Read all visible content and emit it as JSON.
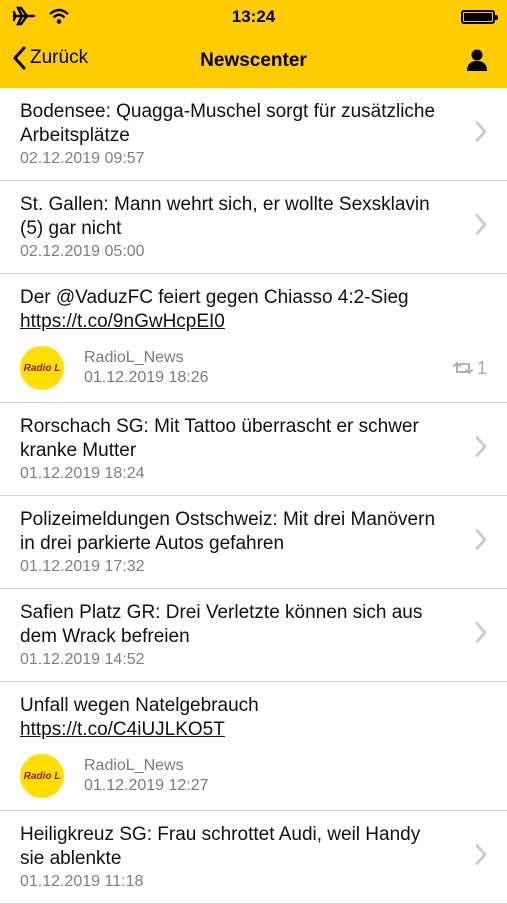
{
  "status": {
    "time": "13:24"
  },
  "nav": {
    "back_label": "Zurück",
    "title": "Newscenter"
  },
  "items": [
    {
      "type": "news",
      "title": "Bodensee: Quagga-Muschel sorgt für zusätzliche Arbeitsplätze",
      "date": "02.12.2019 09:57"
    },
    {
      "type": "news",
      "title": "St. Gallen: Mann wehrt sich, er wollte Sexsklavin (5) gar nicht",
      "date": "02.12.2019 05:00"
    },
    {
      "type": "tweet",
      "text": "Der @VaduzFC feiert gegen Chiasso 4:2-Sieg",
      "link": "https://t.co/9nGwHcpEI0",
      "avatar_text": "Radio L",
      "user": "RadioL_News",
      "date": "01.12.2019 18:26",
      "retweets": "1"
    },
    {
      "type": "news",
      "title": "Rorschach SG: Mit Tattoo überrascht er schwer kranke Mutter",
      "date": "01.12.2019 18:24"
    },
    {
      "type": "news",
      "title": "Polizeimeldungen Ostschweiz: Mit drei Manövern in drei parkierte Autos gefahren",
      "date": "01.12.2019 17:32"
    },
    {
      "type": "news",
      "title": "Safien Platz GR: Drei Verletzte können sich aus dem Wrack befreien",
      "date": "01.12.2019 14:52"
    },
    {
      "type": "tweet",
      "text": "Unfall wegen Natelgebrauch",
      "link": "https://t.co/C4iUJLKO5T",
      "avatar_text": "Radio L",
      "user": "RadioL_News",
      "date": "01.12.2019 12:27",
      "retweets": ""
    },
    {
      "type": "news",
      "title": "Heiligkreuz SG: Frau schrottet Audi, weil Handy sie ablenkte",
      "date": "01.12.2019 11:18"
    }
  ]
}
